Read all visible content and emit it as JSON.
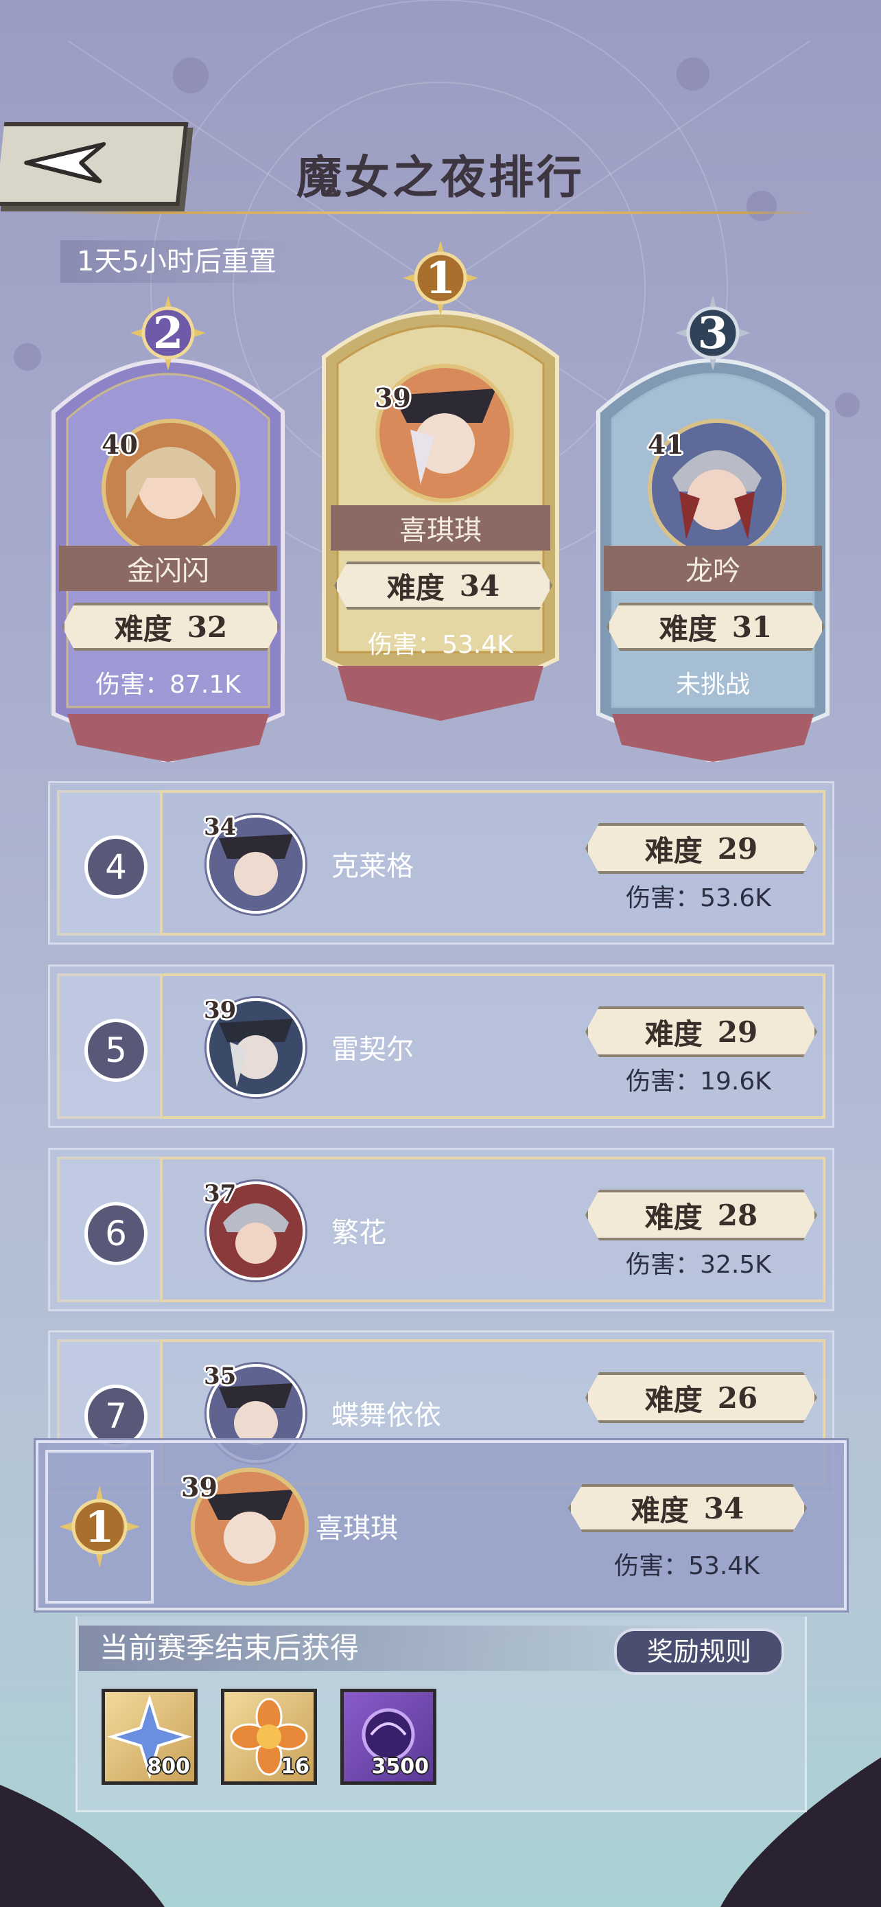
{
  "header": {
    "title": "魔女之夜排行",
    "reset_timer": "1天5小时后重置"
  },
  "podium": [
    {
      "rank": "2",
      "level": "40",
      "name": "金闪闪",
      "difficulty_label": "难度",
      "difficulty": "32",
      "damage": "伤害：87.1K",
      "theme": "#8f86c8"
    },
    {
      "rank": "1",
      "level": "39",
      "name": "喜琪琪",
      "difficulty_label": "难度",
      "difficulty": "34",
      "damage": "伤害：53.4K",
      "theme": "#c9b070"
    },
    {
      "rank": "3",
      "level": "41",
      "name": "龙吟",
      "difficulty_label": "难度",
      "difficulty": "31",
      "damage": "未挑战",
      "theme": "#7f9ab2"
    }
  ],
  "list": [
    {
      "rank": "4",
      "level": "34",
      "name": "克莱格",
      "difficulty_label": "难度",
      "difficulty": "29",
      "damage": "伤害：53.6K"
    },
    {
      "rank": "5",
      "level": "39",
      "name": "雷契尔",
      "difficulty_label": "难度",
      "difficulty": "29",
      "damage": "伤害：19.6K"
    },
    {
      "rank": "6",
      "level": "37",
      "name": "繁花",
      "difficulty_label": "难度",
      "difficulty": "28",
      "damage": "伤害：32.5K"
    },
    {
      "rank": "7",
      "level": "35",
      "name": "蝶舞依依",
      "difficulty_label": "难度",
      "difficulty": "26",
      "damage": ""
    }
  ],
  "my_rank": {
    "rank": "1",
    "level": "39",
    "name": "喜琪琪",
    "difficulty_label": "难度",
    "difficulty": "34",
    "damage": "伤害：53.4K"
  },
  "rewards": {
    "label": "当前赛季结束后获得",
    "rules_button": "奖励规则",
    "items": [
      {
        "icon": "blue-star-crystal-icon",
        "qty": "800"
      },
      {
        "icon": "orange-flower-gem-icon",
        "qty": "16"
      },
      {
        "icon": "purple-orb-icon",
        "qty": "3500"
      }
    ]
  }
}
